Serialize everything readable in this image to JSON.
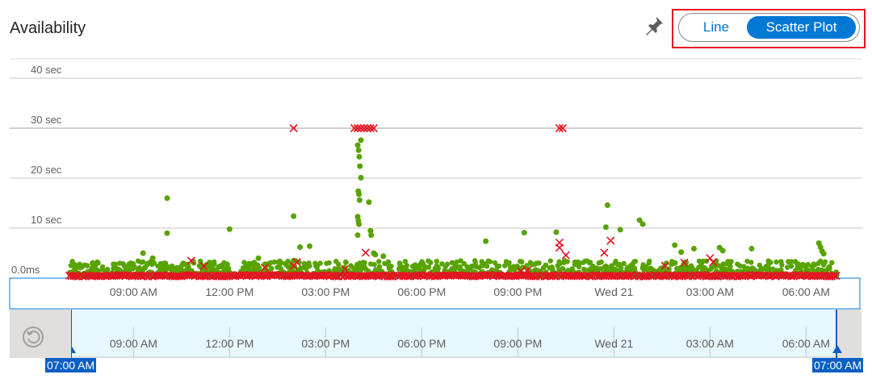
{
  "panel": {
    "title": "Availability"
  },
  "icons": {
    "pin": "pin-icon",
    "reset": "reset-zoom-icon"
  },
  "view_toggle": {
    "options": [
      "Line",
      "Scatter Plot"
    ],
    "selected": "Scatter Plot"
  },
  "chart_data": {
    "type": "scatter",
    "title": "Availability",
    "y_ticks": [
      "0.0ms",
      "10 sec",
      "20 sec",
      "30 sec",
      "40 sec"
    ],
    "ylim_sec": [
      0,
      40
    ],
    "x_ticks": [
      "09:00 AM",
      "12:00 PM",
      "03:00 PM",
      "06:00 PM",
      "09:00 PM",
      "Wed 21",
      "03:00 AM",
      "06:00 AM"
    ],
    "x_range_hours": [
      7,
      31
    ],
    "grid": true,
    "series": [
      {
        "marker": "circle",
        "color": "#57a300",
        "outliers": [
          [
            10.05,
            16
          ],
          [
            10.05,
            9
          ],
          [
            12.0,
            9.8
          ],
          [
            9.3,
            5
          ],
          [
            9.6,
            4
          ],
          [
            12.9,
            4
          ],
          [
            14.0,
            12.4
          ],
          [
            14.2,
            6.2
          ],
          [
            14.5,
            6.4
          ],
          [
            14.0,
            3.5
          ],
          [
            16.0,
            26.6
          ],
          [
            16.03,
            25.6
          ],
          [
            16.05,
            24.3
          ],
          [
            16.07,
            22.4
          ],
          [
            16.1,
            20.1
          ],
          [
            16.02,
            17.4
          ],
          [
            16.04,
            16.8
          ],
          [
            16.06,
            15.6
          ],
          [
            16.0,
            12.3
          ],
          [
            16.02,
            11.5
          ],
          [
            16.04,
            10.8
          ],
          [
            16.0,
            8.6
          ],
          [
            16.1,
            27.6
          ],
          [
            16.35,
            15.2
          ],
          [
            16.4,
            9.5
          ],
          [
            16.42,
            8.6
          ],
          [
            16.5,
            5.0
          ],
          [
            16.55,
            4.7
          ],
          [
            16.8,
            4.4
          ],
          [
            20.0,
            7.4
          ],
          [
            21.2,
            9.1
          ],
          [
            22.2,
            9.2
          ],
          [
            23.8,
            14.6
          ],
          [
            23.75,
            10.2
          ],
          [
            24.2,
            9.7
          ],
          [
            24.8,
            11.6
          ],
          [
            24.9,
            10.8
          ],
          [
            25.9,
            6.6
          ],
          [
            26.1,
            5.2
          ],
          [
            26.5,
            5.9
          ],
          [
            27.3,
            6.1
          ],
          [
            27.4,
            5.5
          ],
          [
            28.3,
            5.9
          ],
          [
            30.4,
            7.0
          ],
          [
            30.45,
            6.2
          ],
          [
            30.5,
            5.4
          ],
          [
            30.55,
            4.9
          ]
        ],
        "band_sec": [
          0.5,
          3.5
        ]
      },
      {
        "marker": "x",
        "color": "#e81123",
        "outliers": [
          [
            14.0,
            30
          ],
          [
            15.9,
            30
          ],
          [
            16.0,
            30
          ],
          [
            16.1,
            30
          ],
          [
            16.2,
            30
          ],
          [
            16.3,
            30
          ],
          [
            16.4,
            30
          ],
          [
            16.5,
            30
          ],
          [
            22.3,
            30
          ],
          [
            22.4,
            30
          ],
          [
            16.25,
            5.1
          ],
          [
            15.6,
            1.8
          ],
          [
            14.1,
            3.2
          ],
          [
            14.0,
            2.5
          ],
          [
            10.8,
            3.5
          ],
          [
            11.2,
            2.4
          ],
          [
            13.1,
            2.1
          ],
          [
            22.3,
            7.1
          ],
          [
            22.3,
            6.1
          ],
          [
            22.5,
            4.6
          ],
          [
            23.9,
            7.5
          ],
          [
            23.7,
            5.1
          ],
          [
            25.6,
            2.5
          ],
          [
            26.2,
            3.1
          ],
          [
            27.0,
            4.0
          ],
          [
            27.1,
            3.2
          ],
          [
            21.1,
            1.4
          ],
          [
            21.3,
            1.6
          ]
        ],
        "baseline_sec": 0
      }
    ]
  }
}
